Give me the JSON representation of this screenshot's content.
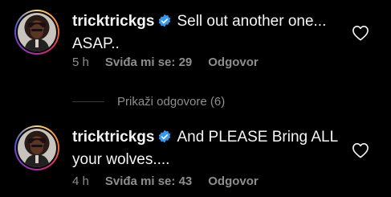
{
  "comments": [
    {
      "username": "tricktrickgs",
      "text": "Sell out another one... ASAP..",
      "time": "5 h",
      "likes": "Sviđa mi se: 29",
      "reply": "Odgovor"
    },
    {
      "username": "tricktrickgs",
      "text": "And PLEASE Bring ALL your wolves....",
      "time": "4 h",
      "likes": "Sviđa mi se: 43",
      "reply": "Odgovor"
    }
  ],
  "view_replies": "Prikaži odgovore (6)",
  "colors": {
    "background": "#000000",
    "text": "#f5f5f5",
    "muted": "#8e8e8e",
    "verified": "#3897f0"
  },
  "icons": {
    "verified": "verified-badge-icon",
    "like": "heart-outline-icon"
  }
}
